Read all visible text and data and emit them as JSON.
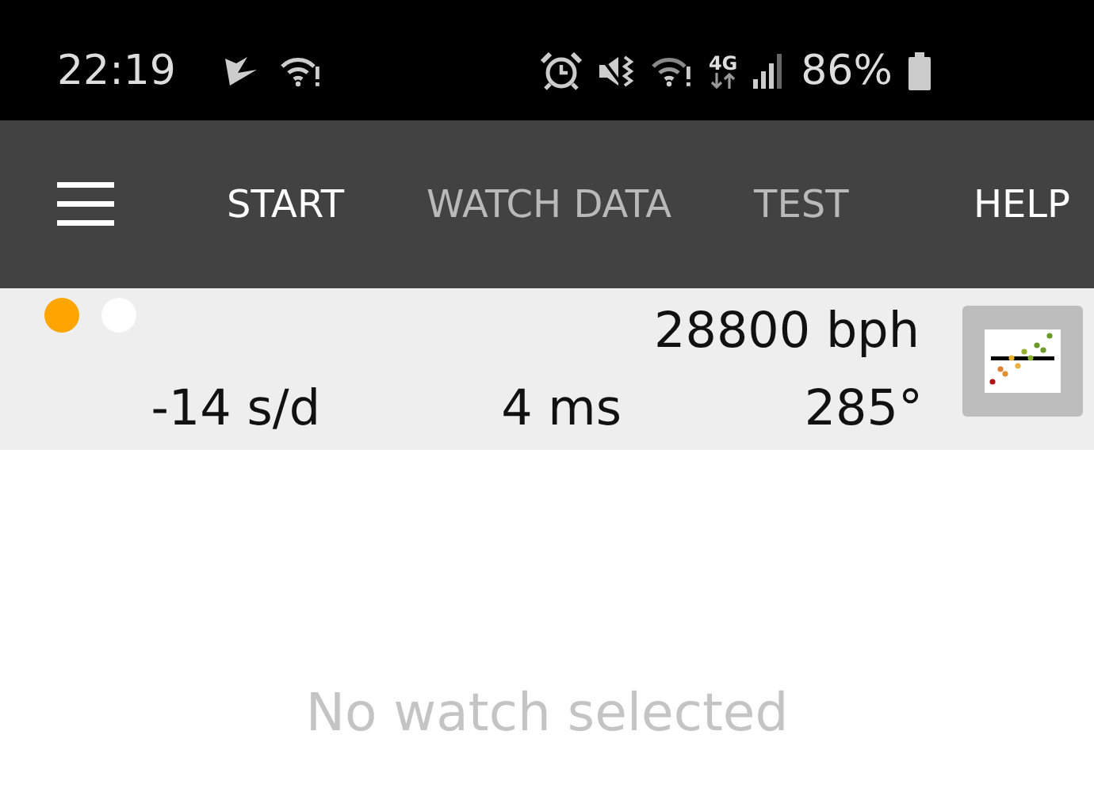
{
  "status_bar": {
    "time": "22:19",
    "network_type": "4G",
    "battery": "86%"
  },
  "app_bar": {
    "tabs": [
      {
        "label": "START",
        "selected": true
      },
      {
        "label": "WATCH DATA",
        "selected": false
      },
      {
        "label": "TEST",
        "selected": false
      }
    ],
    "action": "HELP"
  },
  "measurement": {
    "indicators": [
      {
        "color": "#ffa500"
      },
      {
        "color": "#ffffff"
      }
    ],
    "beat_rate": "28800 bph",
    "rate": "-14 s/d",
    "beat_error": "4 ms",
    "amplitude": "285°"
  },
  "empty_message": "No watch selected"
}
